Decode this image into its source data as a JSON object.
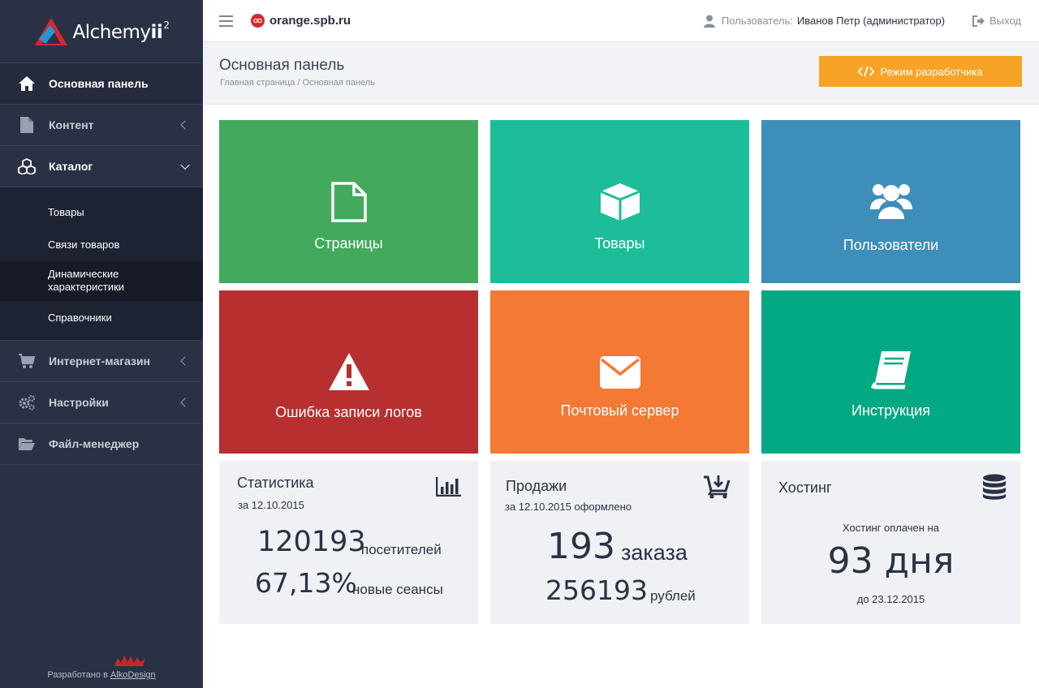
{
  "app": {
    "logo_text": "Alchemy",
    "logo_bold": "ii",
    "logo_sup": "2"
  },
  "sidebar": {
    "items": [
      {
        "label": "Основная панель",
        "icon": "home-icon"
      },
      {
        "label": "Контент",
        "icon": "file-icon"
      },
      {
        "label": "Каталог",
        "icon": "cubes-icon"
      },
      {
        "label": "Интернет-магазин",
        "icon": "cart-icon"
      },
      {
        "label": "Настройки",
        "icon": "gears-icon"
      },
      {
        "label": "Файл-менеджер",
        "icon": "folder-open-icon"
      }
    ],
    "catalog_sub": [
      {
        "label": "Товары"
      },
      {
        "label": "Связи товаров"
      },
      {
        "label": "Динамические характеристики"
      },
      {
        "label": "Справочники"
      }
    ],
    "credits_text": "Разработано в",
    "credits_link": "AlkoDesign"
  },
  "topbar": {
    "site_name": "orange.spb.ru",
    "user_label": "Пользователь:",
    "user_name": "Иванов Петр (администратор)",
    "logout_label": "Выход"
  },
  "header": {
    "title": "Основная панель",
    "breadcrumb_home": "Главная страница",
    "breadcrumb_sep": "/",
    "breadcrumb_current": "Основная панель",
    "dev_button": "Режим разработчика"
  },
  "tiles": [
    {
      "label": "Страницы",
      "color": "#43a95d",
      "icon": "file-outline-icon"
    },
    {
      "label": "Товары",
      "color": "#1ebd9a",
      "icon": "cube-icon"
    },
    {
      "label": "Пользователи",
      "color": "#3d8eb9",
      "icon": "users-icon"
    },
    {
      "label": "Ошибка записи логов",
      "color": "#b82f30",
      "icon": "warning-icon"
    },
    {
      "label": "Почтовый сервер",
      "color": "#f37934",
      "icon": "envelope-icon"
    },
    {
      "label": "Инструкция",
      "color": "#03a983",
      "icon": "book-icon"
    }
  ],
  "stats": {
    "title": "Статистика",
    "date": "за 12.10.2015",
    "visitors_value": "120193",
    "visitors_label": "посетителей",
    "sessions_value": "67,13%",
    "sessions_label": "новые сеансы",
    "icon": "bar-chart-icon"
  },
  "sales": {
    "title": "Продажи",
    "date": "за 12.10.2015 оформлено",
    "orders_value": "193",
    "orders_label": "заказа",
    "rubles_value": "256193",
    "rubles_label": "рублей",
    "icon": "cart-download-icon"
  },
  "hosting": {
    "title": "Хостинг",
    "paid_label": "Хостинг оплачен на",
    "days_value": "93 дня",
    "until": "до 23.12.2015",
    "icon": "database-icon"
  }
}
